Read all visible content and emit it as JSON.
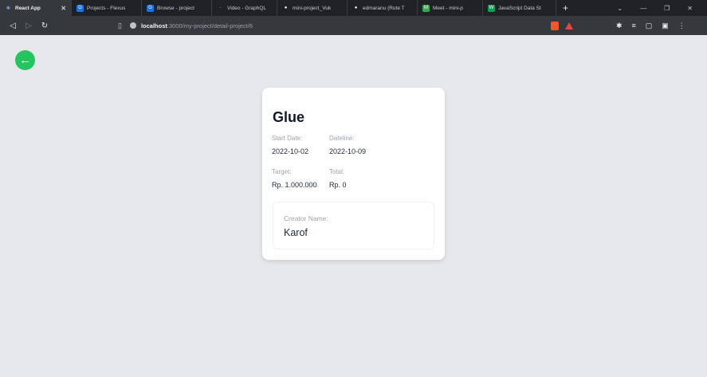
{
  "browser": {
    "tabs": [
      {
        "label": "React App",
        "color": "#5f6368",
        "glyph": "⚛",
        "active": true
      },
      {
        "label": "Projects - Flexus",
        "color": "#1a73e8",
        "glyph": "G",
        "active": false
      },
      {
        "label": "Browse - project",
        "color": "#1a73e8",
        "glyph": "G",
        "active": false
      },
      {
        "label": "Video - GraphQL",
        "color": "#9aa0a6",
        "glyph": "·",
        "active": false
      },
      {
        "label": "mini-project_Vuk",
        "color": "#ffffff",
        "glyph": "●",
        "active": false
      },
      {
        "label": "edmaranu (Rute T",
        "color": "#ffffff",
        "glyph": "●",
        "active": false
      },
      {
        "label": "Meet - mini-p",
        "color": "#34a853",
        "glyph": "M",
        "active": false
      },
      {
        "label": "JavaScript Data St",
        "color": "#0f9d58",
        "glyph": "W",
        "active": false
      }
    ],
    "new_tab": "+",
    "window_controls": [
      "⌄",
      "—",
      "❐",
      "✕"
    ],
    "nav": {
      "back": "◁",
      "forward": "▷",
      "reload": "↻"
    },
    "url_host": "localhost",
    "url_path": ":3000/my-project/detail-project/6",
    "right_icons": [
      "✱",
      "≡",
      "▢",
      "▣",
      "⋮"
    ]
  },
  "page": {
    "back_icon": "←",
    "back_color": "#22c55e",
    "title": "Glue",
    "start_date_label": "Start Date:",
    "start_date_value": "2022-10-02",
    "dateline_label": "Dateline:",
    "dateline_value": "2022-10-09",
    "target_label": "Target:",
    "target_value": "Rp. 1.000.000",
    "total_label": "Total:",
    "total_value": "Rp. 0",
    "creator_label": "Creator Name:",
    "creator_value": "Karof"
  }
}
